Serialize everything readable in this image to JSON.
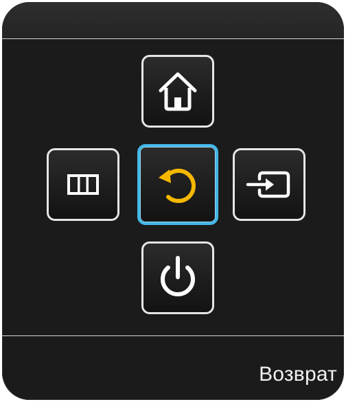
{
  "panel": {
    "buttons": [
      {
        "id": "home",
        "icon": "home-icon"
      },
      {
        "id": "menu",
        "icon": "menu-columns-icon"
      },
      {
        "id": "return",
        "icon": "return-arrow-icon",
        "selected": true
      },
      {
        "id": "source",
        "icon": "input-source-icon"
      },
      {
        "id": "power",
        "icon": "power-icon"
      }
    ],
    "footer_label": "Возврат"
  },
  "colors": {
    "background": "#1b1b1b",
    "button_border": "#e6e6e6",
    "selected_border": "#43b7e8",
    "return_icon": "#f5b800",
    "icon_white": "#ffffff"
  }
}
